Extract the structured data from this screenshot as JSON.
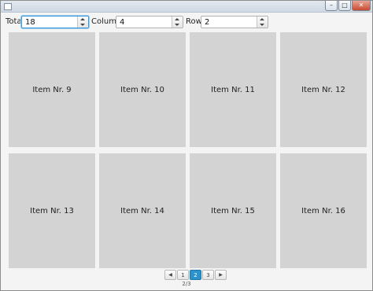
{
  "window": {
    "title": "",
    "controls": {
      "minimize": "–",
      "maximize": "□",
      "close": "✕"
    }
  },
  "toolbar": {
    "total_label": "Total",
    "total_value": "18",
    "columns_label": "Columns",
    "columns_value": "4",
    "rows_label": "Rows",
    "rows_value": "2"
  },
  "grid": {
    "items": [
      "Item Nr. 9",
      "Item Nr. 10",
      "Item Nr. 11",
      "Item Nr. 12",
      "Item Nr. 13",
      "Item Nr. 14",
      "Item Nr. 15",
      "Item Nr. 16"
    ]
  },
  "pagination": {
    "prev_icon": "◀",
    "next_icon": "▶",
    "pages": [
      "1",
      "2",
      "3"
    ],
    "current_page": "2",
    "status": "2/3"
  },
  "colors": {
    "tile": "#d3d3d3",
    "accent": "#2a93cc",
    "focus": "#3a9ad9"
  }
}
